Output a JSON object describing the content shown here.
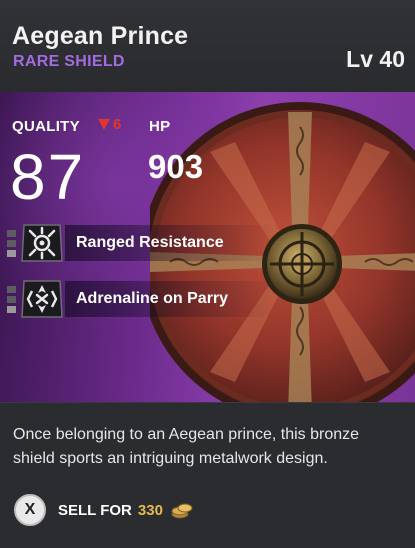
{
  "item": {
    "name": "Aegean Prince",
    "rarity_type": "RARE SHIELD",
    "level": "Lv 40",
    "rarity_color": "#a46be0"
  },
  "stats": {
    "quality_label": "QUALITY",
    "quality_change": "6",
    "quality_change_direction": "down",
    "quality_value": "87",
    "hp_label": "HP",
    "hp_value": "903"
  },
  "perks": [
    {
      "label": "Ranged Resistance",
      "icon": "ranged-resistance-icon",
      "pips_filled": 1,
      "pips_total": 3
    },
    {
      "label": "Adrenaline on Parry",
      "icon": "adrenaline-parry-icon",
      "pips_filled": 1,
      "pips_total": 3
    }
  ],
  "description": "Once belonging to an Aegean prince, this bronze shield sports an intriguing metalwork design.",
  "sell": {
    "button_glyph": "X",
    "label": "SELL FOR",
    "price": "330",
    "currency_icon": "coin-stack-icon",
    "price_color": "#e6b94b"
  }
}
